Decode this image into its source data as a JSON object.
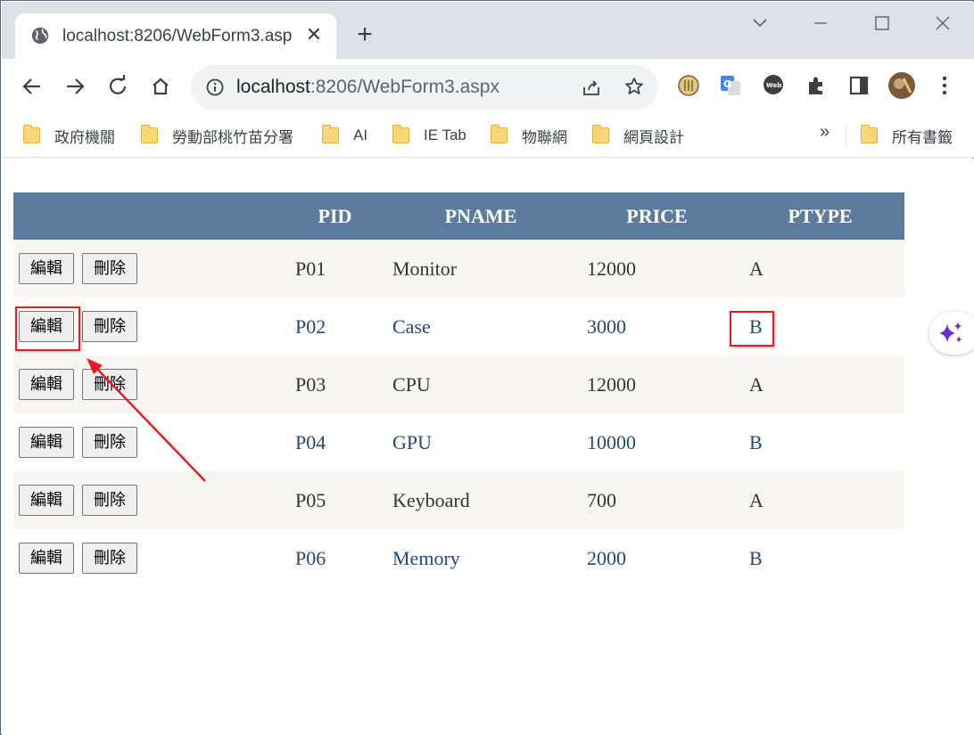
{
  "browser": {
    "tab_title": "localhost:8206/WebForm3.aspx",
    "tab_close": "✕",
    "new_tab": "+",
    "url_host": "localhost",
    "url_rest": ":8206/WebForm3.aspx"
  },
  "bookmarks": [
    {
      "label": "政府機關"
    },
    {
      "label": "勞動部桃竹苗分署"
    },
    {
      "label": "AI"
    },
    {
      "label": "IE Tab"
    },
    {
      "label": "物聯網"
    },
    {
      "label": "網頁設計"
    }
  ],
  "bookmarks_more": "»",
  "bookmarks_all": "所有書籤",
  "grid": {
    "headers": [
      "PID",
      "PNAME",
      "PRICE",
      "PTYPE"
    ],
    "edit_label": "編輯",
    "delete_label": "刪除",
    "rows": [
      {
        "pid": "P01",
        "pname": "Monitor",
        "price": "12000",
        "ptype": "A"
      },
      {
        "pid": "P02",
        "pname": "Case",
        "price": "3000",
        "ptype": "B"
      },
      {
        "pid": "P03",
        "pname": "CPU",
        "price": "12000",
        "ptype": "A"
      },
      {
        "pid": "P04",
        "pname": "GPU",
        "price": "10000",
        "ptype": "B"
      },
      {
        "pid": "P05",
        "pname": "Keyboard",
        "price": "700",
        "ptype": "A"
      },
      {
        "pid": "P06",
        "pname": "Memory",
        "price": "2000",
        "ptype": "B"
      }
    ]
  },
  "colors": {
    "header_bg": "#5d7b9d",
    "row_odd_bg": "#f7f6f3",
    "row_even_text": "#284775",
    "annotation": "#e02020"
  }
}
